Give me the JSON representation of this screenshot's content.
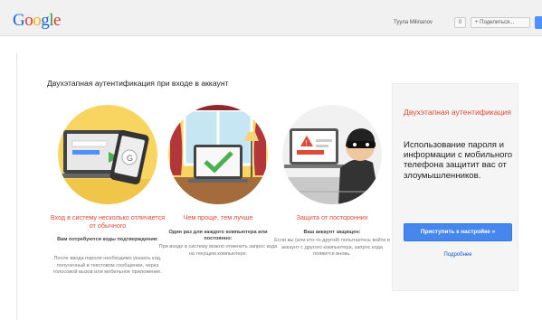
{
  "header": {
    "logo_letters": [
      {
        "char": "G",
        "color": "#1a66d6"
      },
      {
        "char": "o",
        "color": "#dd3a2a"
      },
      {
        "char": "o",
        "color": "#f2b40c"
      },
      {
        "char": "g",
        "color": "#1a66d6"
      },
      {
        "char": "l",
        "color": "#2a9c43"
      },
      {
        "char": "e",
        "color": "#dd3a2a"
      }
    ],
    "user_name": "Туула Milinanov",
    "notifications": "0",
    "share_label": "+ Поделиться...",
    "avatar_color": "#4d90fe"
  },
  "main": {
    "heading": "Двухэтапная аутентификация при входе в аккаунт",
    "features": [
      {
        "illustration": "phone-laptop-icon",
        "caption": "Вход в систему несколько отличается от обычного",
        "bold": "Вам потребуются коды подтверждения:",
        "text": "После ввода пароля необходимо указать код, полученный в текстовом сообщении, через голосовой вызов или мобильное приложение."
      },
      {
        "illustration": "laptop-checkmark-icon",
        "caption": "Чем проще, тем лучше",
        "bold": "Один раз для каждого компьютера или постоянно:",
        "text": "При входе в систему можно отменить запрос кода на текущем компьютере."
      },
      {
        "illustration": "burglar-icon",
        "caption": "Защита от посторонних",
        "bold": "Ваш аккаунт защищен:",
        "text": "Если вы (или кто-то другой) попытаетесь войти в аккаунт с другого компьютера, запрос кода появится вновь."
      }
    ]
  },
  "panel": {
    "title": "Двухэтапная аутентификация",
    "text": "Использование пароля и информации с мобильного телефона защитит вас от злоумышленников.",
    "start_button": "Приступить к настройке »",
    "more_link": "Подробнее"
  },
  "colors": {
    "accent_red": "#dd4b39",
    "button_blue": "#4787ed",
    "link_blue": "#15c",
    "illustration_yellow": "#f7d560"
  }
}
